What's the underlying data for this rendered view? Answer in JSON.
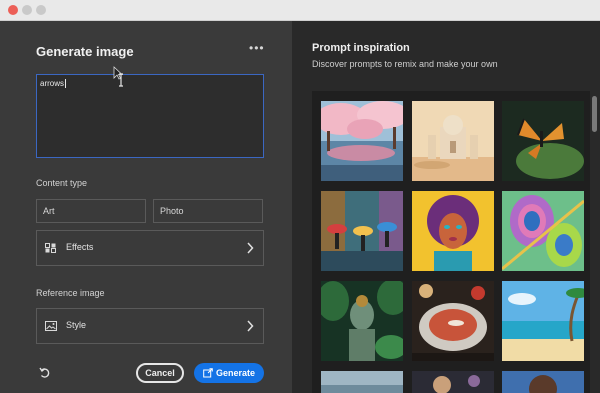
{
  "window": {
    "controls": [
      "close",
      "minimize",
      "zoom"
    ]
  },
  "generate_panel": {
    "title": "Generate image",
    "more_icon": "more-horizontal-icon",
    "prompt_value": "arrows",
    "content_type_label": "Content type",
    "content_type_options": [
      "Art",
      "Photo"
    ],
    "effects_label": "Effects",
    "reference_image_label": "Reference image",
    "style_label": "Style",
    "cancel_label": "Cancel",
    "generate_label": "Generate",
    "accent_color": "#1473e6"
  },
  "inspiration_panel": {
    "title": "Prompt inspiration",
    "subtitle": "Discover prompts to remix and make your own",
    "thumbnails": [
      "cherry-blossom-lake",
      "desert-palace",
      "butterfly-on-leaf",
      "rainy-street-umbrellas",
      "colorful-portrait-afro",
      "peacock-feather",
      "jungle-stone-statue",
      "tomato-soup-bowl",
      "tropical-beach",
      "misty-landscape",
      "planet-scene",
      "woman-portrait"
    ]
  }
}
